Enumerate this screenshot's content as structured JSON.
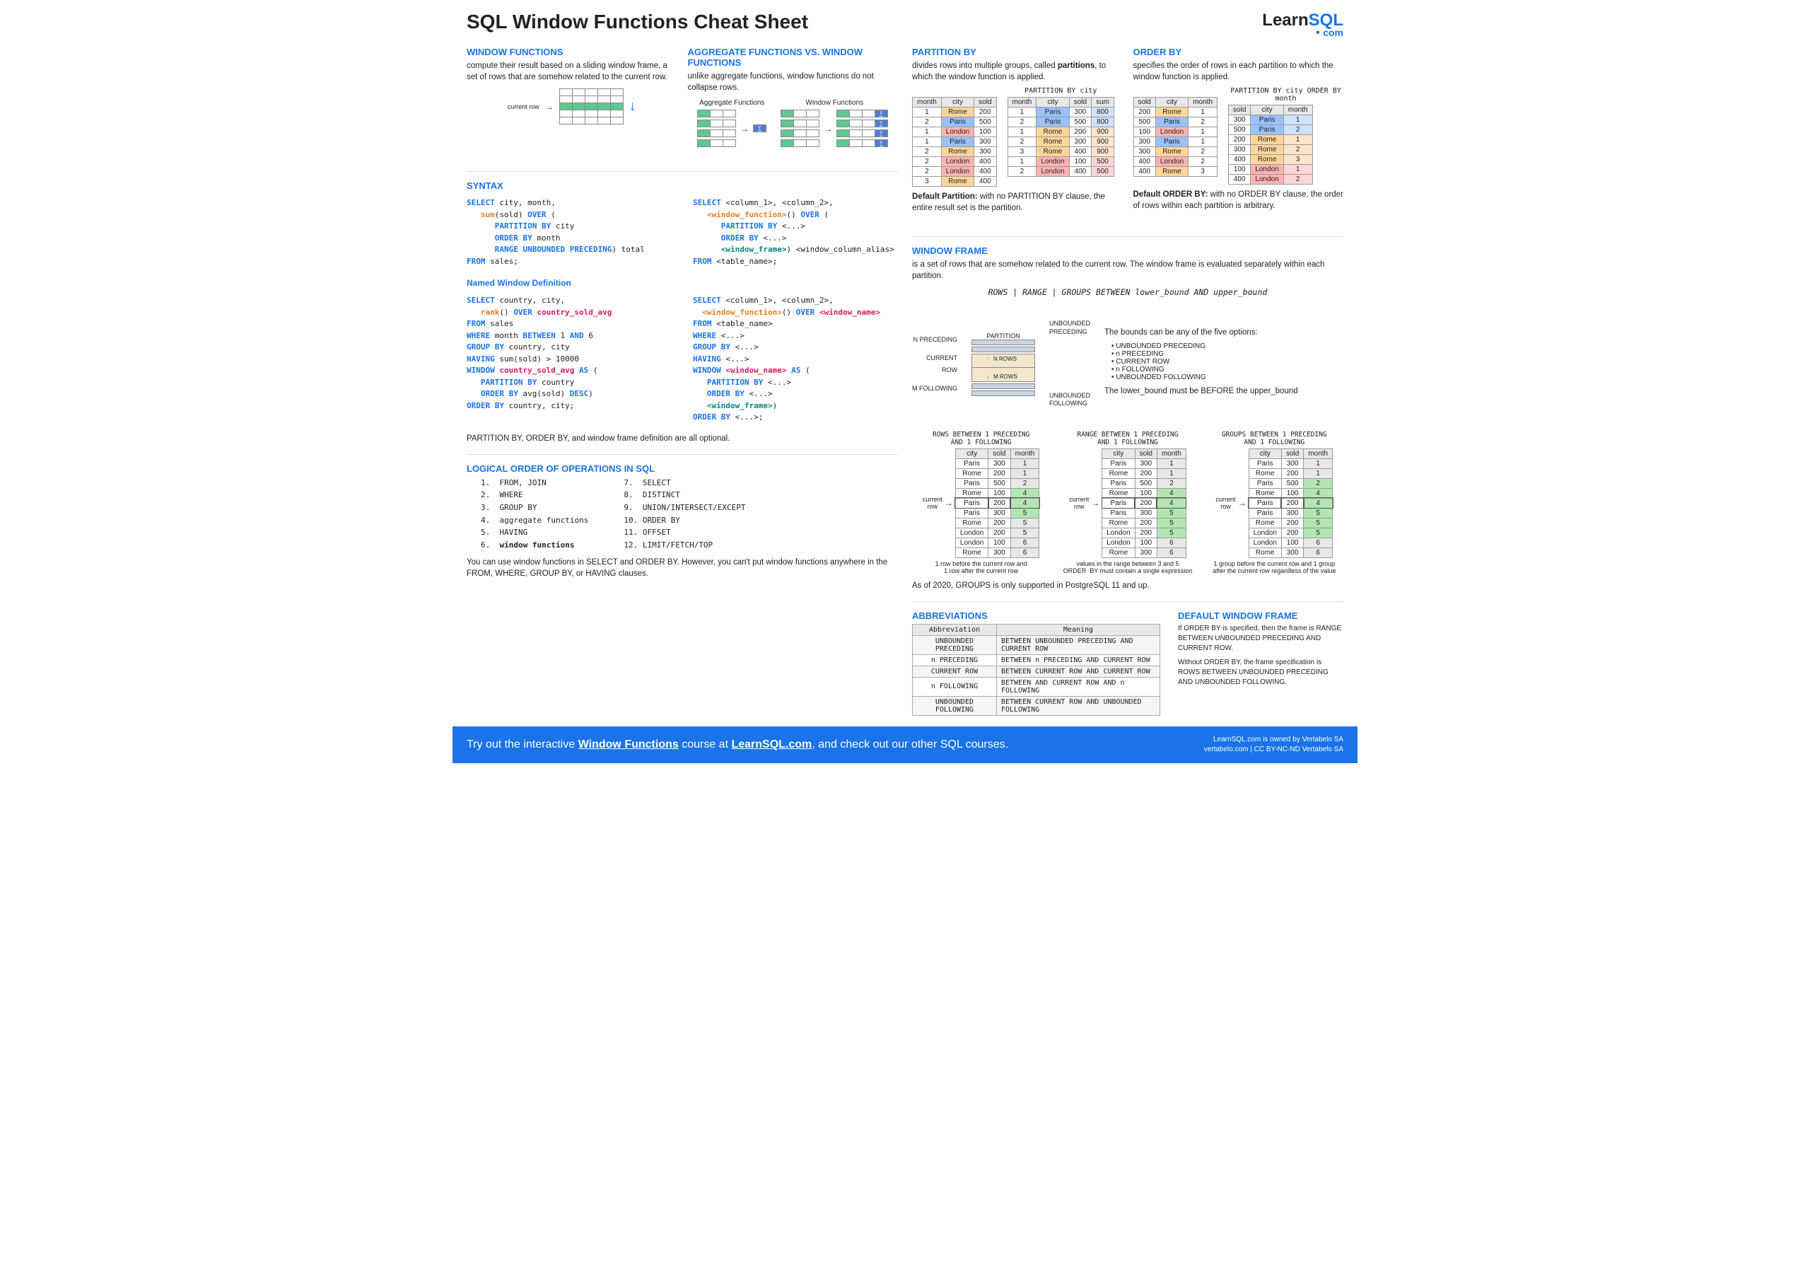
{
  "title": "SQL Window Functions Cheat Sheet",
  "logo": {
    "learn": "Learn",
    "sql": "SQL",
    "com": "com"
  },
  "wf": {
    "heading": "WINDOW FUNCTIONS",
    "text": "compute their result based on a sliding window frame, a set of rows that are somehow related to the current row.",
    "current_row": "current row"
  },
  "agg": {
    "heading": "AGGREGATE FUNCTIONS VS. WINDOW FUNCTIONS",
    "text": "unlike aggregate functions, window functions do not collapse rows.",
    "col_a": "Aggregate Functions",
    "col_b": "Window Functions"
  },
  "syntax": {
    "heading": "SYNTAX",
    "named_heading": "Named Window Definition",
    "note": "PARTITION BY, ORDER BY,  and window frame definition are all optional."
  },
  "logical": {
    "heading": "LOGICAL ORDER OF OPERATIONS IN SQL",
    "items_a": [
      "FROM, JOIN",
      "WHERE",
      "GROUP BY",
      "aggregate functions",
      "HAVING",
      "window functions"
    ],
    "items_b": [
      "SELECT",
      "DISTINCT",
      "UNION/INTERSECT/EXCEPT",
      "ORDER BY",
      "OFFSET",
      "LIMIT/FETCH/TOP"
    ],
    "note": "You can use window functions in SELECT and ORDER BY.  However, you can't put window functions anywhere in the FROM, WHERE, GROUP BY, or HAVING clauses."
  },
  "partition": {
    "heading": "PARTITION BY",
    "text_a": "divides rows into multiple groups, called ",
    "text_b": "partitions",
    "text_c": ", to which the window function is applied.",
    "label": "PARTITION BY city",
    "default_a": "Default Partition:",
    "default_b": " with no PARTITION BY clause, the entire result set is the partition.",
    "tbl_a": {
      "headers": [
        "month",
        "city",
        "sold"
      ],
      "rows": [
        [
          "1",
          "Rome",
          "200"
        ],
        [
          "2",
          "Paris",
          "500"
        ],
        [
          "1",
          "London",
          "100"
        ],
        [
          "1",
          "Paris",
          "300"
        ],
        [
          "2",
          "Rome",
          "300"
        ],
        [
          "2",
          "London",
          "400"
        ],
        [
          "2",
          "London",
          "400"
        ],
        [
          "3",
          "Rome",
          "400"
        ]
      ]
    },
    "tbl_b": {
      "headers": [
        "month",
        "city",
        "sold",
        "sum"
      ],
      "rows": [
        [
          "1",
          "Paris",
          "300",
          "800"
        ],
        [
          "2",
          "Paris",
          "500",
          "800"
        ],
        [
          "1",
          "Rome",
          "200",
          "900"
        ],
        [
          "2",
          "Rome",
          "300",
          "900"
        ],
        [
          "3",
          "Rome",
          "400",
          "900"
        ],
        [
          "1",
          "London",
          "100",
          "500"
        ],
        [
          "2",
          "London",
          "400",
          "500"
        ]
      ]
    }
  },
  "orderby": {
    "heading": "ORDER BY",
    "text": "specifies the order of rows in each partition to which the window function is applied.",
    "label": "PARTITION BY city ORDER BY month",
    "default_a": "Default ORDER BY:",
    "default_b": " with no ORDER BY clause, the order of rows within each partition is arbitrary.",
    "tbl_a": {
      "headers": [
        "sold",
        "city",
        "month"
      ],
      "rows": [
        [
          "200",
          "Rome",
          "1"
        ],
        [
          "500",
          "Paris",
          "2"
        ],
        [
          "100",
          "London",
          "1"
        ],
        [
          "300",
          "Paris",
          "1"
        ],
        [
          "300",
          "Rome",
          "2"
        ],
        [
          "400",
          "London",
          "2"
        ],
        [
          "400",
          "Rome",
          "3"
        ]
      ]
    },
    "tbl_b": {
      "headers": [
        "sold",
        "city",
        "month"
      ],
      "rows": [
        [
          "300",
          "Paris",
          "1"
        ],
        [
          "500",
          "Paris",
          "2"
        ],
        [
          "200",
          "Rome",
          "1"
        ],
        [
          "300",
          "Rome",
          "2"
        ],
        [
          "400",
          "Rome",
          "3"
        ],
        [
          "100",
          "London",
          "1"
        ],
        [
          "400",
          "London",
          "2"
        ]
      ]
    }
  },
  "frame": {
    "heading": "WINDOW FRAME",
    "text": "is a set of rows that are somehow related to the current row. The window frame is evaluated separately within each partition.",
    "syntax": "ROWS | RANGE | GROUPS BETWEEN lower_bound AND upper_bound",
    "diag": {
      "partition": "PARTITION",
      "unbounded_prec": "UNBOUNDED\nPRECEDING",
      "n_prec": "N PRECEDING",
      "n_rows": "N ROWS",
      "current_row": "CURRENT\nROW",
      "m_rows": "M ROWS",
      "m_foll": "M FOLLOWING",
      "unbounded_foll": "UNBOUNDED\nFOLLOWING"
    },
    "bounds_intro": "The bounds can be any of the five options:",
    "bounds": [
      "UNBOUNDED PRECEDING",
      "n PRECEDING",
      "CURRENT ROW",
      "n FOLLOWING",
      "UNBOUNDED FOLLOWING"
    ],
    "bounds_note": "The lower_bound must be BEFORE the upper_bound",
    "row_label": "current\nrow",
    "ex_a": {
      "caption": "ROWS BETWEEN 1 PRECEDING\nAND 1 FOLLOWING",
      "desc": "1 row before the current row and\n1 row after the current row"
    },
    "ex_b": {
      "caption": "RANGE BETWEEN 1 PRECEDING\nAND 1 FOLLOWING",
      "desc": "values in the range between 3 and 5\nORDER  BY must contain a single expression"
    },
    "ex_c": {
      "caption": "GROUPS BETWEEN 1 PRECEDING\nAND 1 FOLLOWING",
      "desc": "1 group before the current row and 1 group\nafter the current row regardless of the value"
    },
    "tbl": {
      "headers": [
        "city",
        "sold",
        "month"
      ],
      "rows": [
        [
          "Paris",
          "300",
          "1"
        ],
        [
          "Rome",
          "200",
          "1"
        ],
        [
          "Paris",
          "500",
          "2"
        ],
        [
          "Rome",
          "100",
          "4"
        ],
        [
          "Paris",
          "200",
          "4"
        ],
        [
          "Paris",
          "300",
          "5"
        ],
        [
          "Rome",
          "200",
          "5"
        ],
        [
          "London",
          "200",
          "5"
        ],
        [
          "London",
          "100",
          "6"
        ],
        [
          "Rome",
          "300",
          "6"
        ]
      ]
    },
    "groups_note": "As of 2020, GROUPS is only supported in PostgreSQL 11 and up."
  },
  "abbrev": {
    "heading": "ABBREVIATIONS",
    "th_a": "Abbreviation",
    "th_b": "Meaning",
    "rows": [
      [
        "UNBOUNDED PRECEDING",
        "BETWEEN UNBOUNDED PRECEDING AND CURRENT ROW"
      ],
      [
        "n PRECEDING",
        "BETWEEN n PRECEDING AND CURRENT ROW"
      ],
      [
        "CURRENT ROW",
        "BETWEEN CURRENT ROW AND CURRENT ROW"
      ],
      [
        "n FOLLOWING",
        "BETWEEN AND CURRENT ROW AND n FOLLOWING"
      ],
      [
        "UNBOUNDED FOLLOWING",
        "BETWEEN CURRENT ROW AND UNBOUNDED FOLLOWING"
      ]
    ]
  },
  "default_frame": {
    "heading": "DEFAULT WINDOW FRAME",
    "p1": "If ORDER BY is specified, then the frame is RANGE BETWEEN UNBOUNDED PRECEDING AND CURRENT ROW.",
    "p2": "Without ORDER BY, the frame specification is ROWS BETWEEN UNBOUNDED PRECEDING AND UNBOUNDED FOLLOWING."
  },
  "footer": {
    "main_a": "Try out the interactive ",
    "link_a": "Window Functions",
    "main_b": " course at ",
    "link_b": "LearnSQL.com",
    "main_c": ", and check out our other SQL courses.",
    "right_a": "LearnSQL.com is owned by Vertabelo SA",
    "right_b": "vertabelo.com | CC BY-NC-ND Vertabelo SA"
  }
}
